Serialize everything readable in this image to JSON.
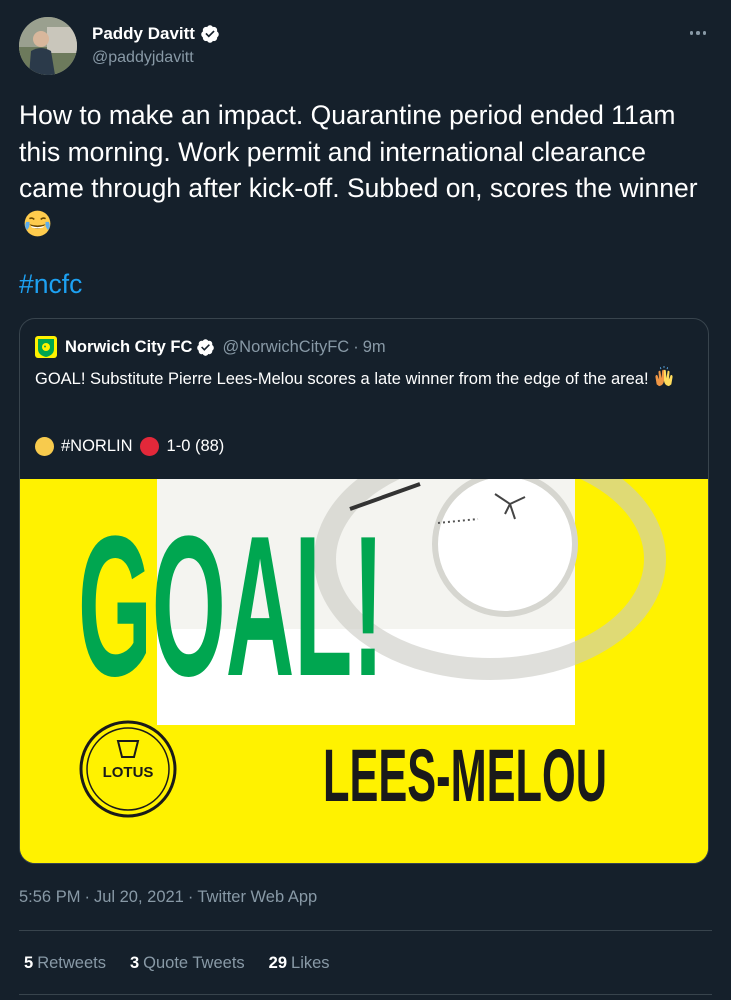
{
  "author": {
    "display_name": "Paddy Davitt",
    "handle": "@paddyjdavitt"
  },
  "tweet": {
    "text": "How to make an impact. Quarantine period ended 11am this morning. Work permit and international clearance came through after kick-off. Subbed on, scores the winner",
    "emoji": "face-with-tears-of-joy",
    "hashtag": "#ncfc"
  },
  "quoted_tweet": {
    "display_name": "Norwich City FC",
    "handle": "@NorwichCityFC",
    "separator": "·",
    "time": "9m",
    "text": "GOAL! Substitute Pierre Lees-Melou scores a late winner from the edge of the area!",
    "emoji": "raising-hands",
    "score_tag": "#NORLIN",
    "score": "1-0 (88)",
    "media": {
      "headline": "GOAL!",
      "player": "LEES-MELOU",
      "sponsor": "LOTUS"
    }
  },
  "meta": {
    "time": "5:56 PM",
    "date": "Jul 20, 2021",
    "source": "Twitter Web App",
    "separator": "·"
  },
  "stats": {
    "retweets_count": "5",
    "retweets_label": "Retweets",
    "quotes_count": "3",
    "quotes_label": "Quote Tweets",
    "likes_count": "29",
    "likes_label": "Likes"
  },
  "colors": {
    "background": "#15202b",
    "accent": "#1da1f2",
    "secondary_text": "#8899a6",
    "border": "#38444d",
    "norwich_yellow": "#fff200",
    "norwich_green": "#00a650"
  }
}
